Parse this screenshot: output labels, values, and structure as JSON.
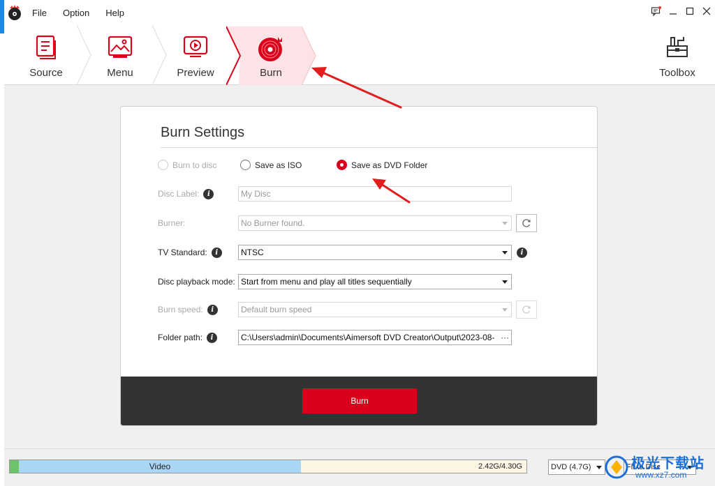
{
  "menu": {
    "file": "File",
    "option": "Option",
    "help": "Help"
  },
  "steps": [
    {
      "label": "Source"
    },
    {
      "label": "Menu"
    },
    {
      "label": "Preview"
    },
    {
      "label": "Burn"
    }
  ],
  "toolbox": {
    "label": "Toolbox"
  },
  "burn_settings": {
    "title": "Burn Settings",
    "output_options": {
      "burn_to_disc": "Burn to disc",
      "save_as_iso": "Save as ISO",
      "save_as_dvd_folder": "Save as DVD Folder",
      "selected": "Save as DVD Folder"
    },
    "disc_label": {
      "label": "Disc Label:",
      "value": "My Disc"
    },
    "burner": {
      "label": "Burner:",
      "value": "No Burner found."
    },
    "tv_standard": {
      "label": "TV Standard:",
      "value": "NTSC"
    },
    "playback_mode": {
      "label": "Disc playback mode:",
      "value": "Start from menu and play all titles sequentially"
    },
    "burn_speed": {
      "label": "Burn speed:",
      "value": "Default burn speed"
    },
    "folder_path": {
      "label": "Folder path:",
      "value": "C:\\Users\\admin\\Documents\\Aimersoft DVD Creator\\Output\\2023-08-",
      "browse": "···"
    },
    "burn_button": "Burn"
  },
  "status": {
    "video_label": "Video",
    "size": "2.42G/4.30G",
    "used_fraction": 0.563,
    "disc_type": "DVD (4.7G)",
    "fit_mode": "Fit to Disc"
  },
  "watermark": {
    "text": "极光下载站",
    "url": "www.xz7.com"
  },
  "colors": {
    "accent": "#d9001b",
    "footer": "#333333",
    "video_bar": "#a9d6f5",
    "menu_bar": "#6cc36a"
  }
}
